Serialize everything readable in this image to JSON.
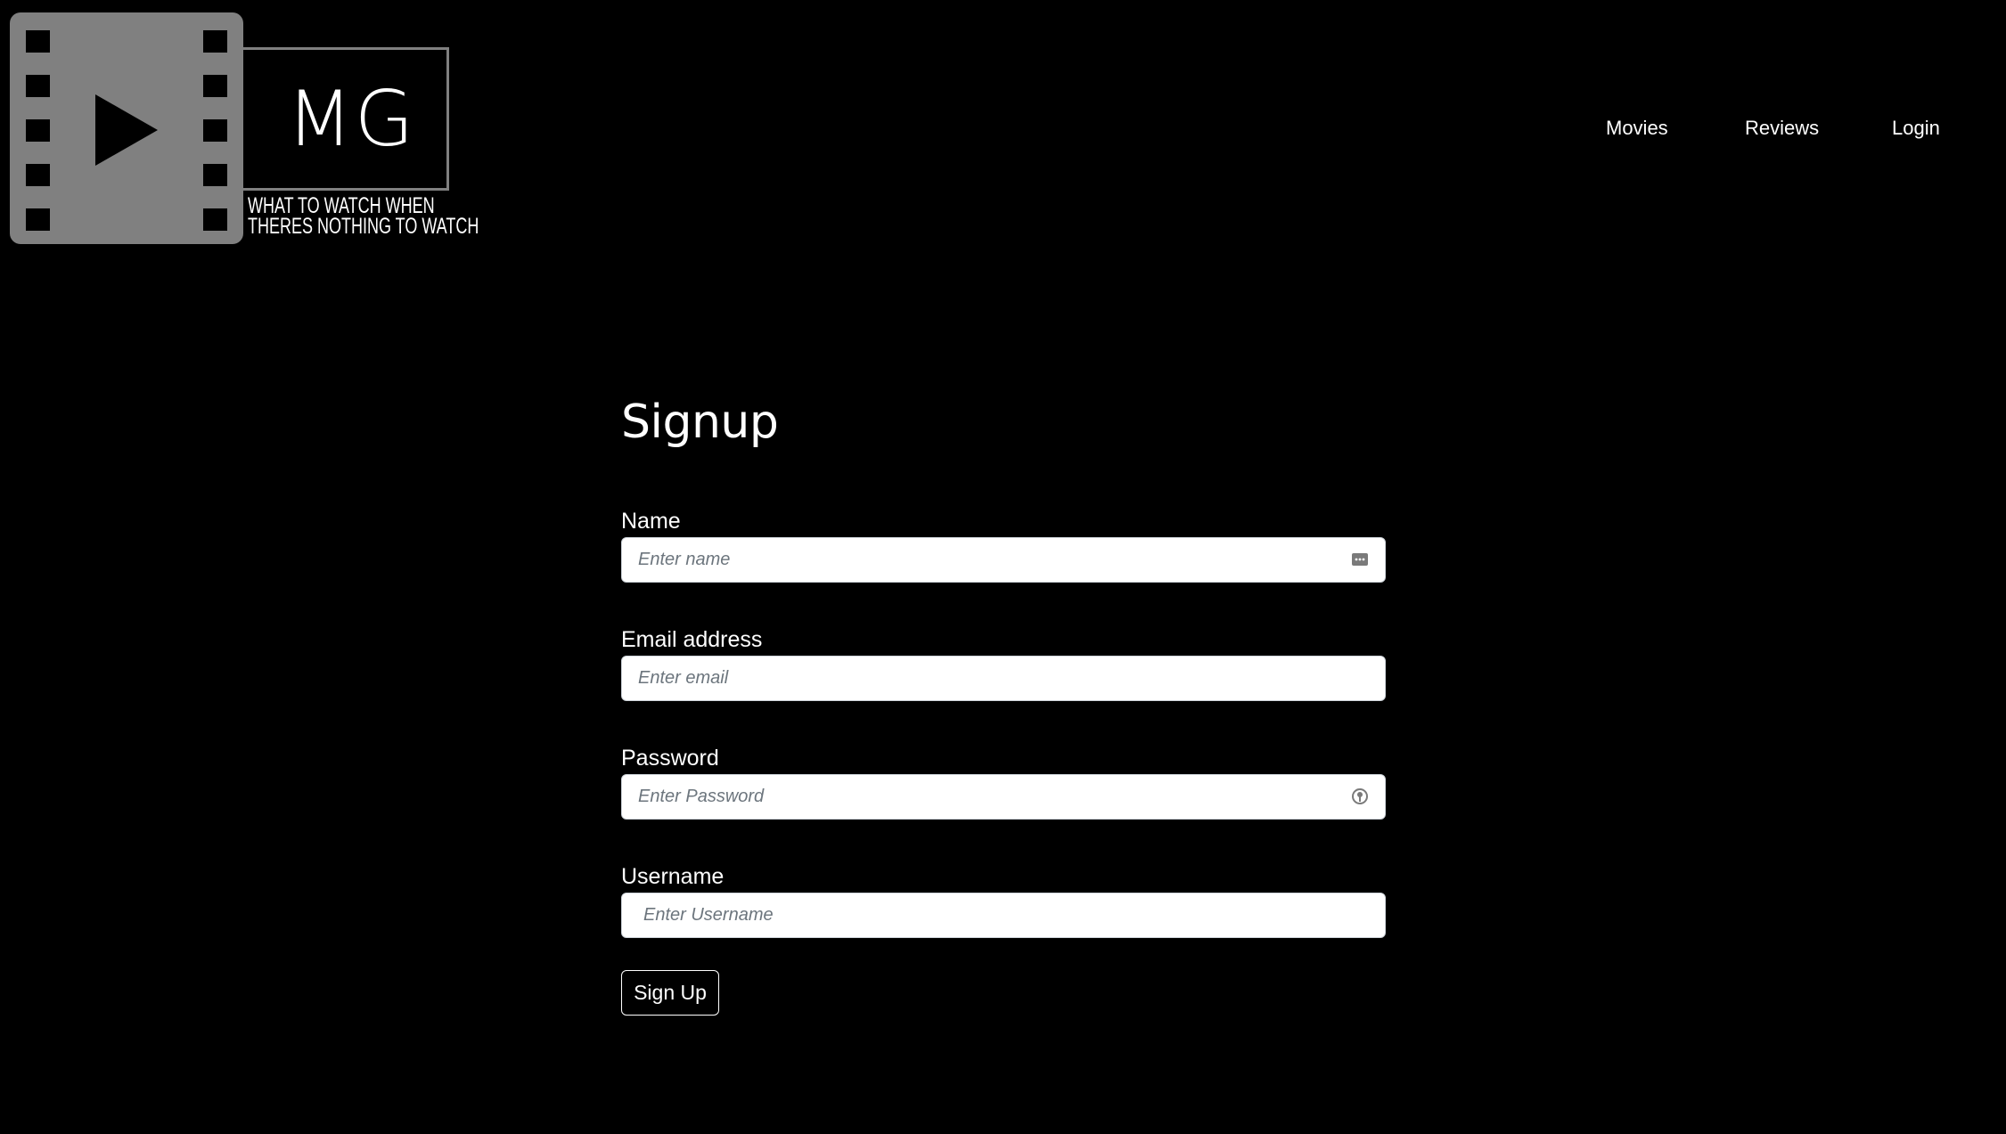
{
  "brand": {
    "logo_text": "MG",
    "tagline_line1": "WHAT TO WATCH WHEN",
    "tagline_line2": "THERES NOTHING TO WATCH"
  },
  "nav": {
    "items": [
      {
        "label": "Movies"
      },
      {
        "label": "Reviews"
      },
      {
        "label": "Login"
      }
    ]
  },
  "form": {
    "title": "Signup",
    "fields": [
      {
        "label": "Name",
        "placeholder": "Enter name",
        "value": "",
        "icon": "autofill-contact-icon"
      },
      {
        "label": "Email address",
        "placeholder": "Enter email",
        "value": ""
      },
      {
        "label": "Password",
        "placeholder": "Enter Password",
        "value": "",
        "icon": "password-key-icon"
      },
      {
        "label": "Username",
        "placeholder": "Enter Username",
        "value": ""
      }
    ],
    "submit_label": "Sign Up"
  },
  "colors": {
    "background": "#000000",
    "text": "#ffffff",
    "logo_gray": "#808080",
    "input_bg": "#ffffff",
    "placeholder": "#6c757d"
  }
}
